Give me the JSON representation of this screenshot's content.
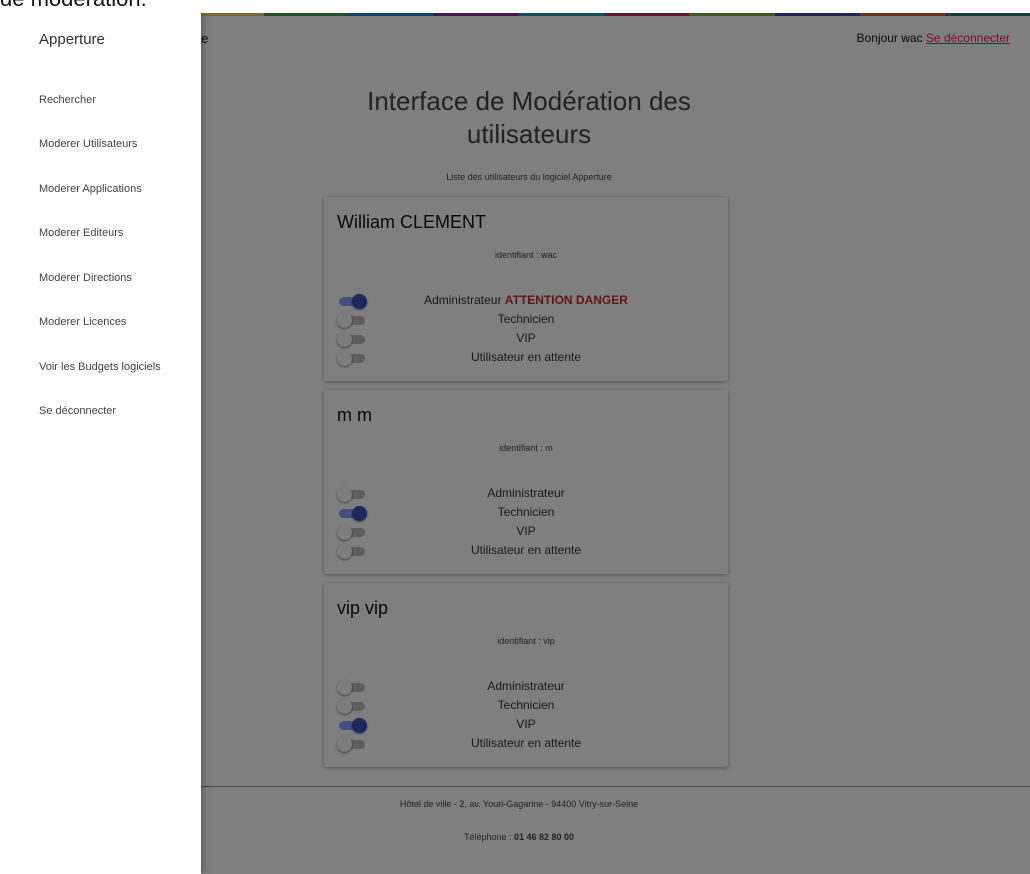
{
  "caption": "de modération.",
  "accent_colors": [
    "#e53935",
    "#fb8c00",
    "#fdd835",
    "#43a047",
    "#1e88e5",
    "#8e24aa",
    "#00acc1",
    "#e91e63",
    "#7cb342",
    "#3949ab",
    "#f4511e",
    "#00897b"
  ],
  "header": {
    "left_text": "e",
    "greeting": "Bonjour wac",
    "logout_link": "Se déconnecter"
  },
  "page": {
    "title": "Interface de Modération des utilisateurs",
    "subtitle": "Liste des utilisateurs du logiciel Apperture"
  },
  "ident_prefix": "identifiant : ",
  "users": [
    {
      "name": "William CLEMENT",
      "ident": "identifiant : wac",
      "roles": [
        {
          "label": "Administrateur",
          "extra": "ATTENTION DANGER",
          "on": true
        },
        {
          "label": "Technicien",
          "on": false
        },
        {
          "label": "VIP",
          "on": false
        },
        {
          "label": "Utilisateur en attente",
          "on": false
        }
      ]
    },
    {
      "name": "m m",
      "ident": "identifiant : m",
      "roles": [
        {
          "label": "Administrateur",
          "on": false
        },
        {
          "label": "Technicien",
          "on": true
        },
        {
          "label": "VIP",
          "on": false
        },
        {
          "label": "Utilisateur en attente",
          "on": false
        }
      ]
    },
    {
      "name": "vip vip",
      "ident": "identifiant : vip",
      "roles": [
        {
          "label": "Administrateur",
          "on": false
        },
        {
          "label": "Technicien",
          "on": false
        },
        {
          "label": "VIP",
          "on": true
        },
        {
          "label": "Utilisateur en attente",
          "on": false
        }
      ]
    }
  ],
  "footer": {
    "address": "Hôtel de ville - 2, av. Youri-Gagarine - 94400 Vitry-sur-Seine",
    "phone_label": "Téléphone : ",
    "phone_number": "01 46 82 80 00"
  },
  "drawer": {
    "title": "Apperture",
    "items": [
      {
        "label": "Rechercher"
      },
      {
        "label": "Moderer Utilisateurs"
      },
      {
        "label": "Moderer Applications"
      },
      {
        "label": "Moderer Editeurs"
      },
      {
        "label": "Moderer Directions"
      },
      {
        "label": "Moderer Licences"
      },
      {
        "label": "Voir les Budgets logiciels"
      },
      {
        "label": "Se déconnecter"
      }
    ]
  }
}
